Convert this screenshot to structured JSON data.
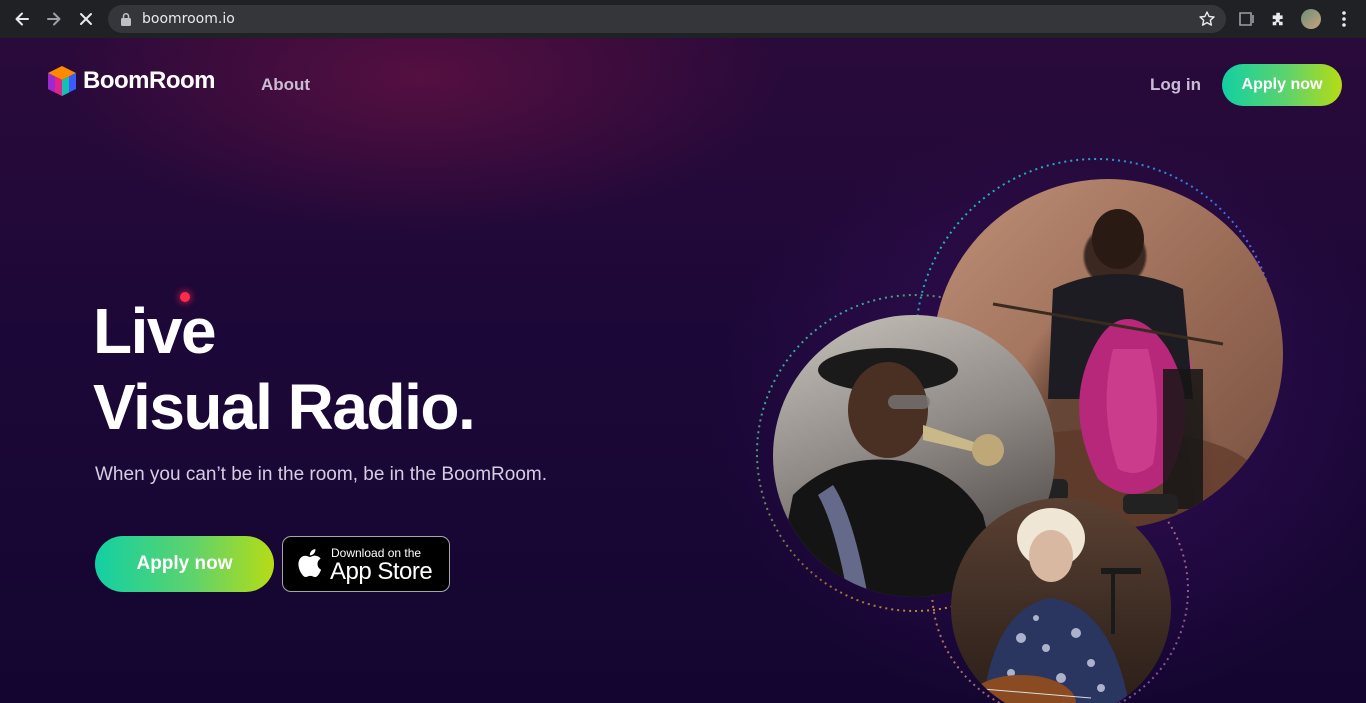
{
  "browser": {
    "url": "boomroom.io"
  },
  "nav": {
    "brand": "BoomRoom",
    "about": "About",
    "login": "Log in",
    "apply": "Apply now"
  },
  "hero": {
    "title_line1": "Live",
    "title_line2": "Visual Radio.",
    "subtitle": "When you can’t be in the room, be in the BoomRoom.",
    "apply": "Apply now",
    "appstore_small": "Download on the",
    "appstore_big": "App Store"
  },
  "colors": {
    "accent_gradient_start": "#12d0a3",
    "accent_gradient_end": "#b6dc14",
    "background": "#1c0838",
    "live_dot": "#ff2a4a"
  },
  "icons": [
    "back-icon",
    "forward-icon",
    "stop-icon",
    "lock-icon",
    "star-icon",
    "cast-icon",
    "extensions-icon",
    "profile-avatar",
    "menu-icon",
    "apple-icon"
  ]
}
